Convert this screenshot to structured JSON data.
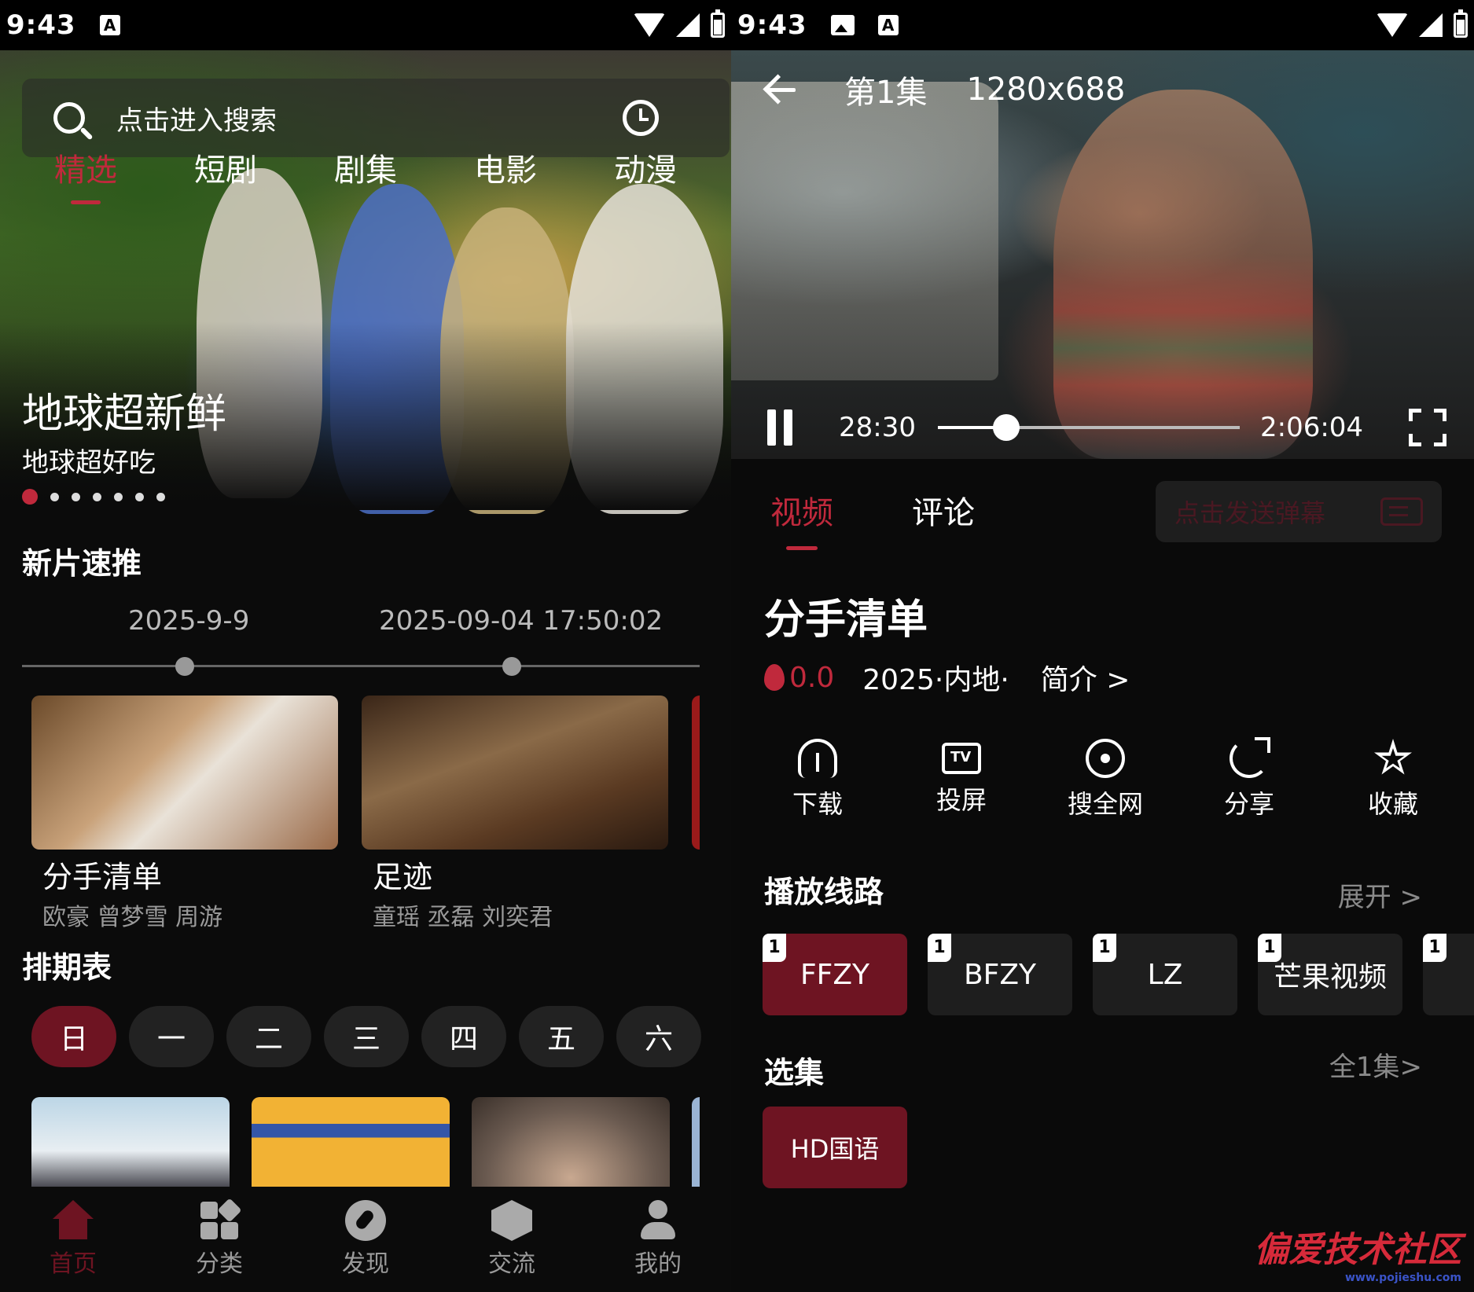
{
  "status_left": {
    "time": "9:43"
  },
  "status_right": {
    "time": "9:43"
  },
  "home": {
    "search": {
      "placeholder": "点击进入搜索"
    },
    "tabs": [
      "精选",
      "短剧",
      "剧集",
      "电影",
      "动漫"
    ],
    "active_tab": 0,
    "banner": {
      "title": "地球超新鲜",
      "subtitle": "地球超好吃",
      "slide_count": 7,
      "active_slide": 0
    },
    "new_section_title": "新片速推",
    "timeline_dates": [
      "2025-9-9",
      "2025-09-04 17:50:02"
    ],
    "new_releases": [
      {
        "name": "分手清单",
        "cast": "欧豪 曾梦雪 周游"
      },
      {
        "name": "足迹",
        "cast": "童瑶 丞磊 刘奕君"
      }
    ],
    "schedule_title": "排期表",
    "weekdays": [
      "日",
      "一",
      "二",
      "三",
      "四",
      "五",
      "六"
    ],
    "active_day": 0,
    "bottom_nav": [
      "首页",
      "分类",
      "发现",
      "交流",
      "我的"
    ],
    "active_nav": 0
  },
  "detail": {
    "episode": "第1集",
    "resolution": "1280x688",
    "current_time": "28:30",
    "duration": "2:06:04",
    "progress": 0.2256,
    "tabs": [
      "视频",
      "评论"
    ],
    "active_tab": 0,
    "danmu_placeholder": "点击发送弹幕",
    "title": "分手清单",
    "rating": "0.0",
    "year_region": "2025·内地·",
    "intro_link": "简介 >",
    "actions": [
      {
        "label": "下载",
        "icon": "download-icon"
      },
      {
        "label": "投屏",
        "icon": "tv-icon"
      },
      {
        "label": "搜全网",
        "icon": "broadcast-icon"
      },
      {
        "label": "分享",
        "icon": "share-icon"
      },
      {
        "label": "收藏",
        "icon": "star-icon"
      }
    ],
    "routes_title": "播放线路",
    "routes_more": "展开 >",
    "routes": [
      {
        "name": "FFZY",
        "badge": "1"
      },
      {
        "name": "BFZY",
        "badge": "1"
      },
      {
        "name": "LZ",
        "badge": "1"
      },
      {
        "name": "芒果视频",
        "badge": "1"
      },
      {
        "name": "",
        "badge": "1"
      }
    ],
    "active_route": 0,
    "episodes_title": "选集",
    "episodes_more": "全1集>",
    "episodes": [
      "HD国语"
    ]
  },
  "watermark": {
    "main": "偏爱技术社区",
    "url": "www.pojieshu.com"
  },
  "colors": {
    "accent": "#c0293c",
    "accent_dark": "#6e1422",
    "bg": "#0b0b0b"
  }
}
